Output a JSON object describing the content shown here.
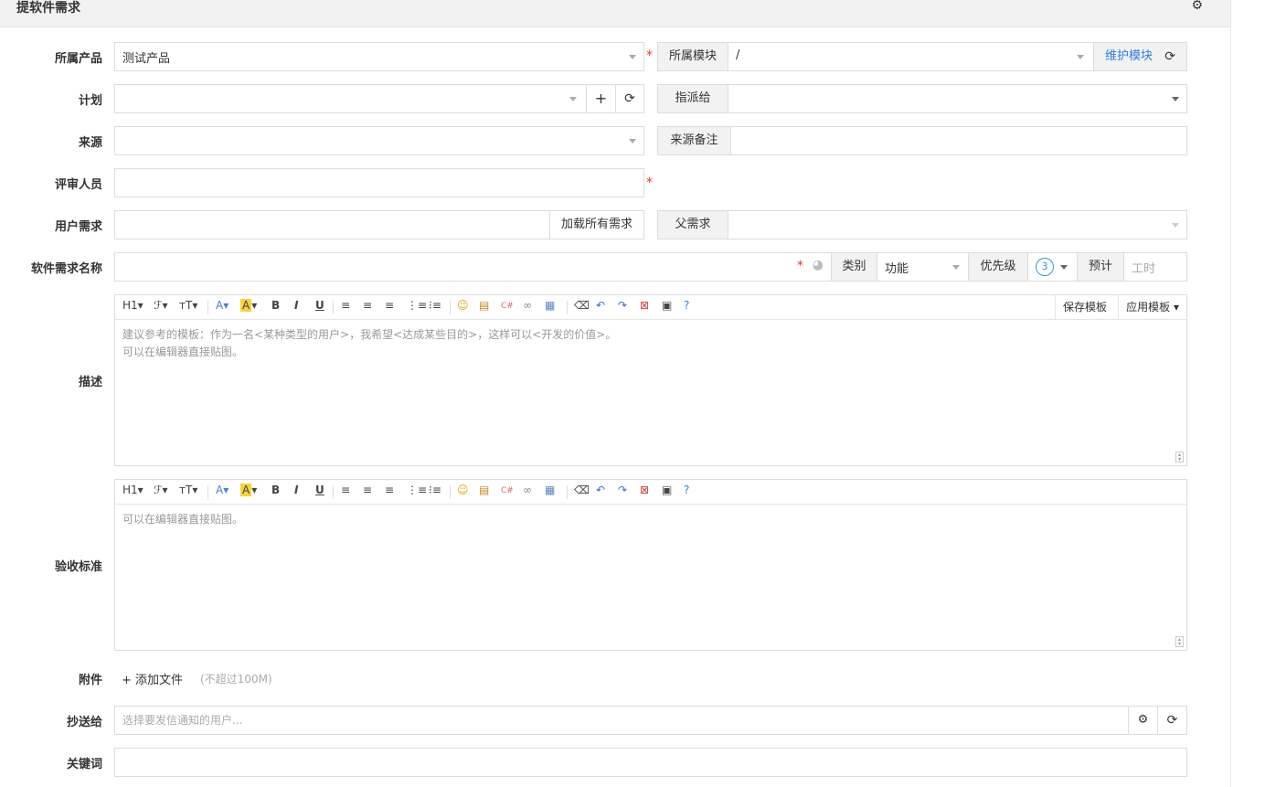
{
  "header": {
    "title": "提软件需求",
    "settings_icon": "gear-icon"
  },
  "form": {
    "product": {
      "label": "所属产品",
      "value": "测试产品"
    },
    "module": {
      "label": "所属模块",
      "value": "/",
      "maintain": "维护模块"
    },
    "plan": {
      "label": "计划",
      "value": ""
    },
    "assign": {
      "label": "指派给",
      "value": ""
    },
    "source": {
      "label": "来源",
      "value": ""
    },
    "source_note": {
      "label": "来源备注",
      "value": ""
    },
    "reviewer": {
      "label": "评审人员",
      "value": ""
    },
    "user_req": {
      "label": "用户需求",
      "load_all": "加载所有需求"
    },
    "parent": {
      "label": "父需求",
      "value": ""
    },
    "title": {
      "label": "软件需求名称",
      "value": ""
    },
    "category": {
      "label": "类别",
      "value": "功能"
    },
    "priority": {
      "label": "优先级",
      "value": "3"
    },
    "estimate": {
      "label": "预计",
      "placeholder": "工时"
    },
    "desc": {
      "label": "描述",
      "line1": "建议参考的模板：作为一名<某种类型的用户>，我希望<达成某些目的>，这样可以<开发的价值>。",
      "line2": "可以在编辑器直接贴图。"
    },
    "verify": {
      "label": "验收标准",
      "line1": "可以在编辑器直接贴图。"
    },
    "toolbar": {
      "heading": "H1",
      "font": "ℱ",
      "size": "тT",
      "font_color": "A",
      "bg_color": "A",
      "bold": "B",
      "italic": "I",
      "underline": "U",
      "save_template": "保存模板",
      "apply_template": "应用模板"
    },
    "attach": {
      "label": "附件",
      "add": "添加文件",
      "limit": "(不超过100M)"
    },
    "mailto": {
      "label": "抄送给",
      "placeholder": "选择要发信通知的用户..."
    },
    "keywords": {
      "label": "关键词",
      "value": ""
    }
  }
}
